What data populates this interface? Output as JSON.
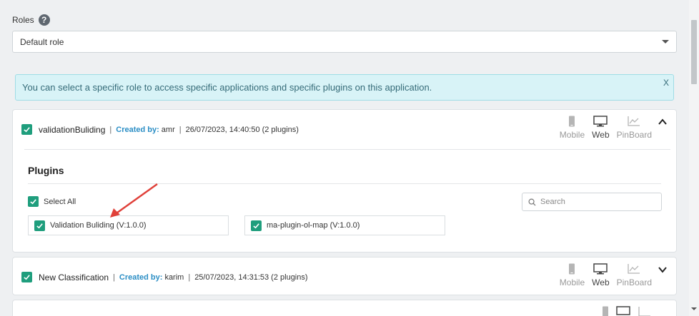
{
  "roles": {
    "label": "Roles",
    "help_glyph": "?",
    "selected": "Default role"
  },
  "alert": {
    "message": "You can select a specific role to access specific applications and specific plugins on this application.",
    "close": "X"
  },
  "apps": [
    {
      "name": "validationBuliding",
      "sep1": "|",
      "created_by_label": "Created by:",
      "creator": "amr",
      "sep2": "|",
      "date": "26/07/2023, 14:40:50",
      "plugin_count": "(2 plugins)",
      "expanded": true,
      "platforms": [
        {
          "label": "Mobile",
          "icon": "mobile-icon",
          "active": false
        },
        {
          "label": "Web",
          "icon": "monitor-icon",
          "active": true
        },
        {
          "label": "PinBoard",
          "icon": "chart-icon",
          "active": false
        }
      ],
      "plugins_title": "Plugins",
      "select_all": "Select All",
      "search_placeholder": "Search",
      "plugins": [
        {
          "label": "Validation Buliding (V:1.0.0)",
          "checked": true
        },
        {
          "label": "ma-plugin-ol-map (V:1.0.0)",
          "checked": true
        }
      ]
    },
    {
      "name": "New Classification",
      "sep1": "|",
      "created_by_label": "Created by:",
      "creator": "karim",
      "sep2": "|",
      "date": "25/07/2023, 14:31:53",
      "plugin_count": "(2 plugins)",
      "expanded": false,
      "platforms": [
        {
          "label": "Mobile",
          "icon": "mobile-icon",
          "active": false
        },
        {
          "label": "Web",
          "icon": "monitor-icon",
          "active": true
        },
        {
          "label": "PinBoard",
          "icon": "chart-icon",
          "active": false
        }
      ]
    }
  ],
  "colors": {
    "checkbox": "#1f9e7d",
    "created_by": "#2b8ec5",
    "alert_bg": "#d8f3f7",
    "alert_text": "#356b78",
    "annotation_arrow": "#e0413a"
  }
}
